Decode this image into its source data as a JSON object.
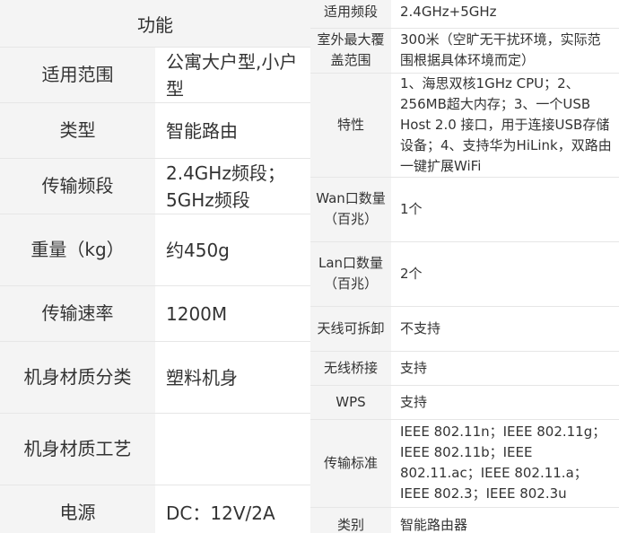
{
  "left_table": {
    "header": "功能",
    "rows": [
      {
        "key": "适用范围",
        "value": "公寓大户型,小户型"
      },
      {
        "key": "类型",
        "value": "智能路由"
      },
      {
        "key": "传输频段",
        "value": "2.4GHz频段；5GHz频段"
      },
      {
        "key": "重量（kg）",
        "value": "约450g"
      },
      {
        "key": "传输速率",
        "value": "1200M"
      },
      {
        "key": "机身材质分类",
        "value": "塑料机身"
      },
      {
        "key": "机身材质工艺",
        "value": ""
      },
      {
        "key": "电源",
        "value": "DC：12V/2A"
      }
    ]
  },
  "right_table": {
    "rows": [
      {
        "key": "适用频段",
        "value": "2.4GHz+5GHz"
      },
      {
        "key": "室外最大覆盖范围",
        "value": "300米（空旷无干扰环境，实际范围根据具体环境而定）"
      },
      {
        "key": "特性",
        "value": "1、海思双核1GHz CPU；2、256MB超大内存；3、一个USB Host 2.0 接口，用于连接USB存储设备；4、支持华为HiLink，双路由一键扩展WiFi"
      },
      {
        "key": "Wan口数量（百兆）",
        "value": "1个"
      },
      {
        "key": "Lan口数量（百兆）",
        "value": "2个"
      },
      {
        "key": "天线可拆卸",
        "value": "不支持"
      },
      {
        "key": "无线桥接",
        "value": "支持"
      },
      {
        "key": "WPS",
        "value": "支持"
      },
      {
        "key": "传输标准",
        "value": "IEEE 802.11n；IEEE 802.11g；IEEE 802.11b；IEEE 802.11.ac；IEEE 802.11.a；IEEE 802.3；IEEE 802.3u"
      },
      {
        "key": "类别",
        "value": "智能路由器"
      }
    ]
  }
}
